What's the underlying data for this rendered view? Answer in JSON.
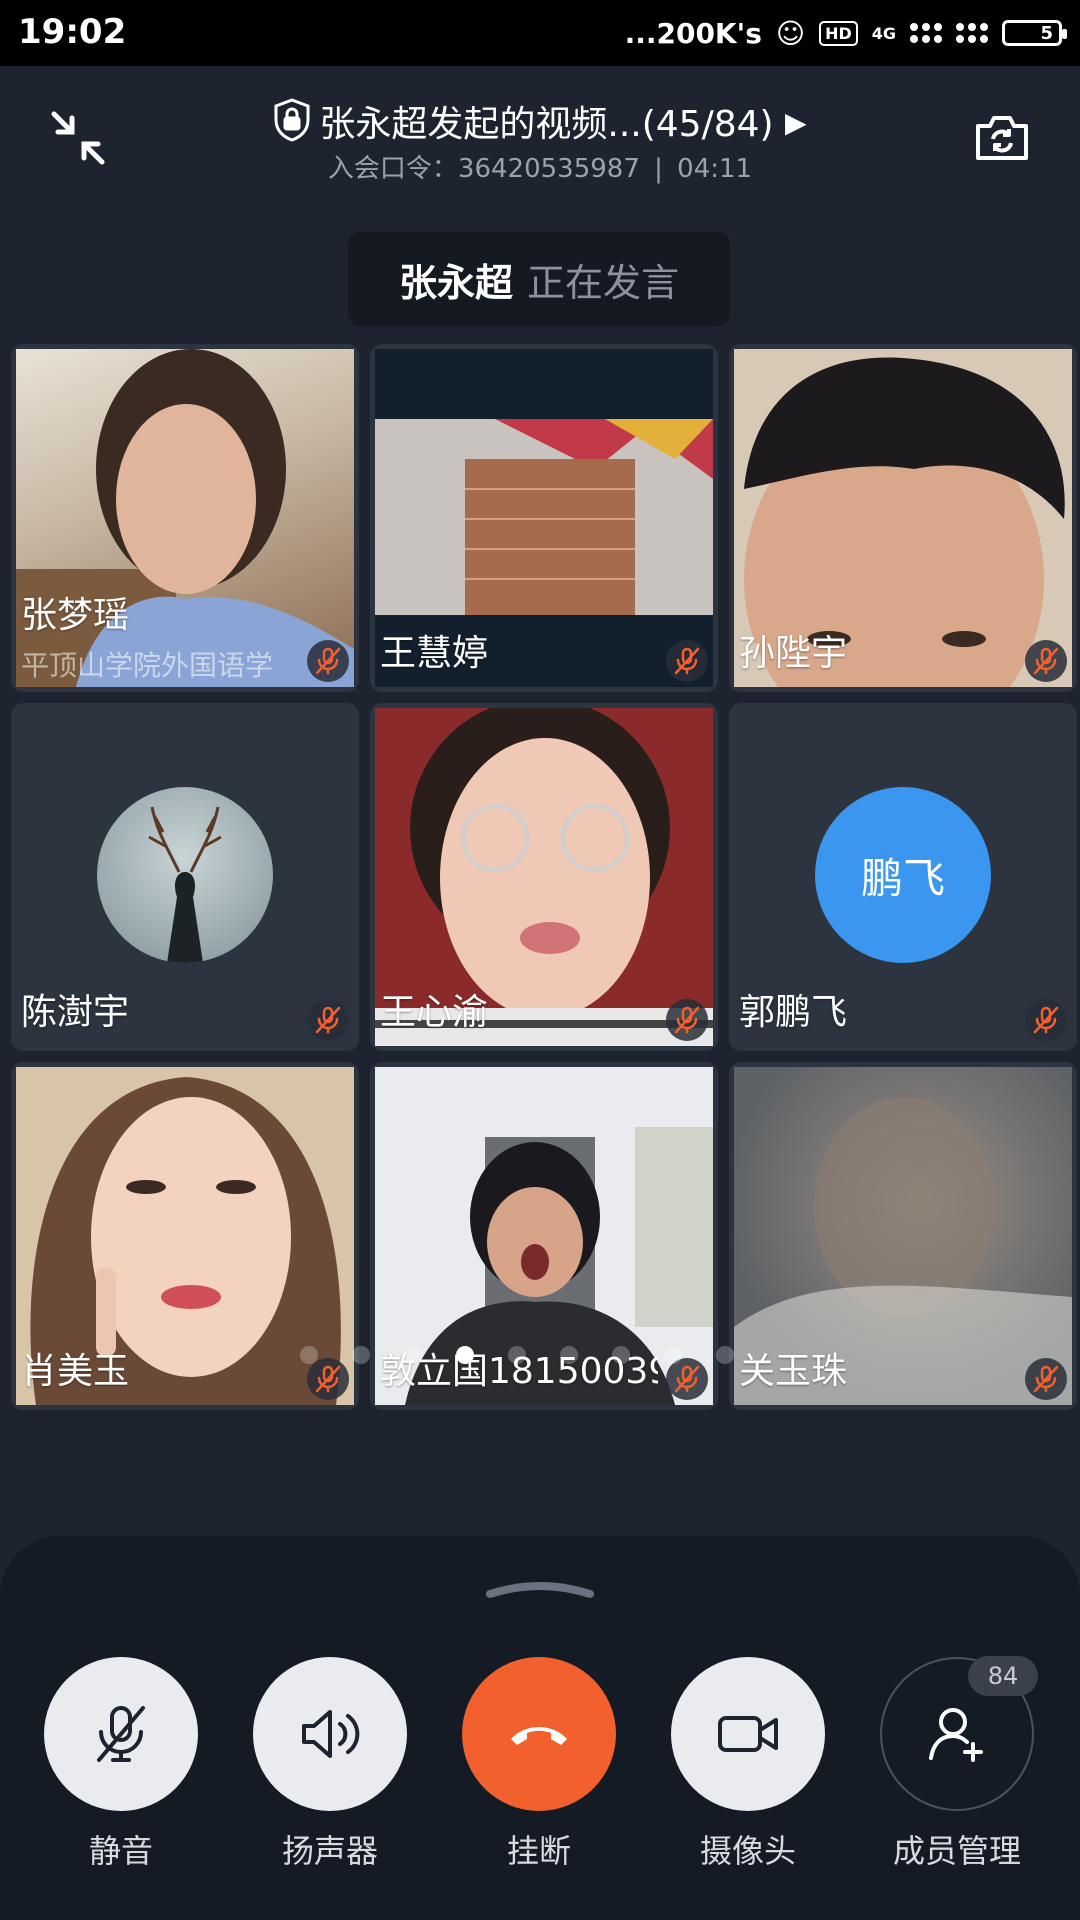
{
  "status_bar": {
    "time": "19:02",
    "speed": "...200K's",
    "hd": "HD",
    "network": "4G",
    "battery": "5"
  },
  "header": {
    "title": "张永超发起的视频...(45/84)",
    "meeting_code_label": "入会口令：",
    "meeting_code": "36420535987",
    "separator": "|",
    "duration": "04:11"
  },
  "speaker": {
    "name": "张永超",
    "status": "正在发言"
  },
  "participants": [
    {
      "name": "张梦瑶",
      "subtitle": "平顶山学院外国语学",
      "muted": true
    },
    {
      "name": "王慧婷",
      "muted": true
    },
    {
      "name": "孙陛宇",
      "muted": true
    },
    {
      "name": "陈澍宇",
      "muted": true
    },
    {
      "name": "王心渝",
      "muted": true
    },
    {
      "name": "郭鹏飞",
      "avatar_text": "鹏飞",
      "avatar_color": "#3a96ee",
      "muted": true
    },
    {
      "name": "肖美玉",
      "muted": true
    },
    {
      "name": "敦立国18150039",
      "muted": true
    },
    {
      "name": "关玉珠",
      "muted": true
    }
  ],
  "controls": [
    {
      "label": "静音"
    },
    {
      "label": "扬声器"
    },
    {
      "label": "挂断"
    },
    {
      "label": "摄像头"
    },
    {
      "label": "成员管理",
      "badge": "84"
    }
  ],
  "colors": {
    "hangup": "#f2602d",
    "avatar_blue": "#3a96ee",
    "mute_icon": "#f2602d"
  }
}
